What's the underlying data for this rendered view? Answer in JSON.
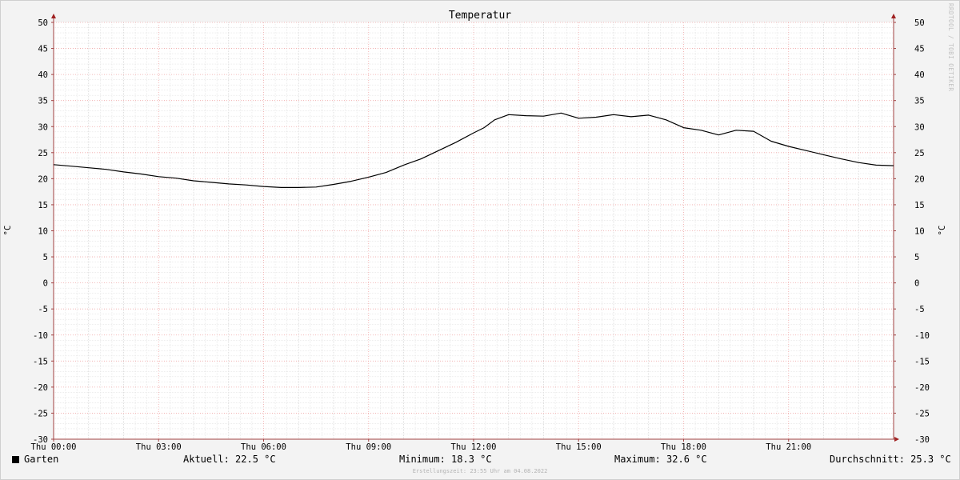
{
  "chart_data": {
    "type": "line",
    "title": "Temperatur",
    "ylabel": "°C",
    "ylim": [
      -30,
      50
    ],
    "yticks": [
      50,
      45,
      40,
      35,
      30,
      25,
      20,
      15,
      10,
      5,
      0,
      -5,
      -10,
      -15,
      -20,
      -25,
      -30
    ],
    "xlim": [
      0,
      24
    ],
    "xticks": [
      {
        "hour": 0,
        "label": "Thu 00:00"
      },
      {
        "hour": 3,
        "label": "Thu 03:00"
      },
      {
        "hour": 6,
        "label": "Thu 06:00"
      },
      {
        "hour": 9,
        "label": "Thu 09:00"
      },
      {
        "hour": 12,
        "label": "Thu 12:00"
      },
      {
        "hour": 15,
        "label": "Thu 15:00"
      },
      {
        "hour": 18,
        "label": "Thu 18:00"
      },
      {
        "hour": 21,
        "label": "Thu 21:00"
      }
    ],
    "grid": true,
    "series": [
      {
        "name": "Garten",
        "color": "#000000",
        "x": [
          0,
          0.5,
          1,
          1.5,
          2,
          2.5,
          3,
          3.5,
          4,
          4.5,
          5,
          5.5,
          6,
          6.5,
          7,
          7.5,
          8,
          8.5,
          9,
          9.5,
          10,
          10.5,
          11,
          11.5,
          12,
          12.3,
          12.6,
          13,
          13.5,
          14,
          14.5,
          15,
          15.5,
          16,
          16.5,
          17,
          17.5,
          18,
          18.5,
          19,
          19.5,
          20,
          20.5,
          21,
          21.5,
          22,
          22.5,
          23,
          23.5,
          24
        ],
        "values": [
          22.7,
          22.4,
          22.1,
          21.8,
          21.3,
          20.9,
          20.4,
          20.1,
          19.6,
          19.3,
          19.0,
          18.8,
          18.5,
          18.3,
          18.3,
          18.4,
          18.9,
          19.5,
          20.3,
          21.2,
          22.6,
          23.8,
          25.4,
          27.0,
          28.8,
          29.8,
          31.3,
          32.3,
          32.1,
          32.0,
          32.6,
          31.6,
          31.8,
          32.3,
          31.9,
          32.2,
          31.3,
          29.8,
          29.3,
          28.4,
          29.3,
          29.1,
          27.2,
          26.2,
          25.4,
          24.6,
          23.8,
          23.1,
          22.6,
          22.5
        ]
      }
    ],
    "legend_placement": "bottom-left"
  },
  "legend": {
    "series_name": "Garten",
    "current": "Aktuell: 22.5 °C",
    "minimum": "Minimum: 18.3 °C",
    "maximum": "Maximum: 32.6 °C",
    "average": "Durchschnitt: 25.3 °C"
  },
  "footer": "Erstellungszeit: 23:55 Uhr am 04.08.2022",
  "watermark": "RRDTOOL / TOBI OETIKER"
}
